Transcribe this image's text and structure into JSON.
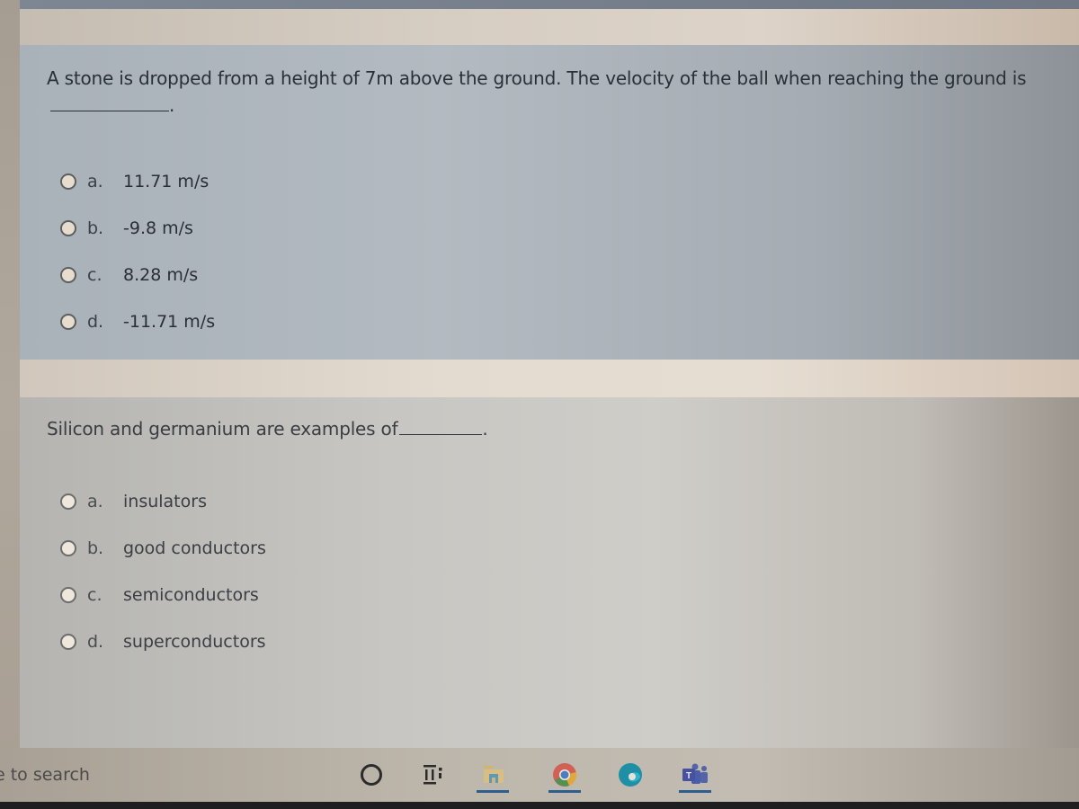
{
  "quiz": {
    "questions": [
      {
        "text": "A stone is dropped from a height of 7m above the ground. The velocity of the ball when reaching the ground is",
        "suffix": ".",
        "selected": null,
        "answers": [
          {
            "letter": "a.",
            "text": "11.71 m/s"
          },
          {
            "letter": "b.",
            "text": "-9.8 m/s"
          },
          {
            "letter": "c.",
            "text": "8.28 m/s"
          },
          {
            "letter": "d.",
            "text": "-11.71 m/s"
          }
        ]
      },
      {
        "text": "Silicon and germanium are examples of",
        "suffix": ".",
        "selected": null,
        "answers": [
          {
            "letter": "a.",
            "text": "insulators"
          },
          {
            "letter": "b.",
            "text": "good conductors"
          },
          {
            "letter": "c.",
            "text": "semiconductors"
          },
          {
            "letter": "d.",
            "text": "superconductors"
          }
        ]
      }
    ]
  },
  "taskbar": {
    "search_placeholder": "e to search",
    "icons": [
      {
        "name": "cortana-icon"
      },
      {
        "name": "task-view-icon"
      },
      {
        "name": "file-explorer-icon",
        "active": true
      },
      {
        "name": "chrome-icon",
        "active": true
      },
      {
        "name": "edge-icon"
      },
      {
        "name": "teams-icon",
        "active": true
      }
    ],
    "accent_color": "#2c5f8e"
  },
  "colors": {
    "question_text": "#2a3038",
    "taskbar_bg": "#bdb6ab",
    "teams_purple": "#4b5ca8",
    "edge_teal": "#1f8fa6"
  }
}
